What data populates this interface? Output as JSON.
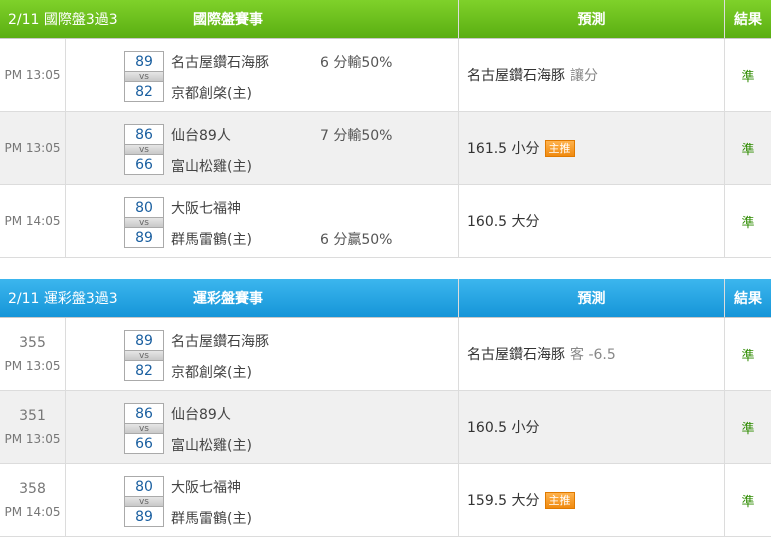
{
  "panels": [
    {
      "header": {
        "date_title": "2/11 國際盤3過3",
        "section_title": "國際盤賽事",
        "prediction": "預測",
        "result": "結果"
      },
      "rows": [
        {
          "game_no": "",
          "time": "PM 13:05",
          "away_score": "89",
          "vs": "vs",
          "home_score": "82",
          "away_team": "名古屋鑽石海豚",
          "home_team": "京都創棨(主)",
          "spread_top": "6 分輸50%",
          "spread_bottom": "",
          "pick": "名古屋鑽石海豚",
          "pick_extra": "讓分",
          "badge": "",
          "result": "準"
        },
        {
          "game_no": "",
          "time": "PM 13:05",
          "away_score": "86",
          "vs": "vs",
          "home_score": "66",
          "away_team": "仙台89人",
          "home_team": "富山松雞(主)",
          "spread_top": "7 分輸50%",
          "spread_bottom": "",
          "pick": "161.5 小分",
          "pick_extra": "",
          "badge": "主推",
          "result": "準"
        },
        {
          "game_no": "",
          "time": "PM 14:05",
          "away_score": "80",
          "vs": "vs",
          "home_score": "89",
          "away_team": "大阪七福神",
          "home_team": "群馬雷鶴(主)",
          "spread_top": "",
          "spread_bottom": "6 分贏50%",
          "pick": "160.5 大分",
          "pick_extra": "",
          "badge": "",
          "result": "準"
        }
      ]
    },
    {
      "header": {
        "date_title": "2/11 運彩盤3過3",
        "section_title": "運彩盤賽事",
        "prediction": "預測",
        "result": "結果"
      },
      "rows": [
        {
          "game_no": "355",
          "time": "PM 13:05",
          "away_score": "89",
          "vs": "vs",
          "home_score": "82",
          "away_team": "名古屋鑽石海豚",
          "home_team": "京都創棨(主)",
          "spread_top": "",
          "spread_bottom": "",
          "pick": "名古屋鑽石海豚",
          "pick_extra": "客 -6.5",
          "badge": "",
          "result": "準"
        },
        {
          "game_no": "351",
          "time": "PM 13:05",
          "away_score": "86",
          "vs": "vs",
          "home_score": "66",
          "away_team": "仙台89人",
          "home_team": "富山松雞(主)",
          "spread_top": "",
          "spread_bottom": "",
          "pick": "160.5 小分",
          "pick_extra": "",
          "badge": "",
          "result": "準"
        },
        {
          "game_no": "358",
          "time": "PM 14:05",
          "away_score": "80",
          "vs": "vs",
          "home_score": "89",
          "away_team": "大阪七福神",
          "home_team": "群馬雷鶴(主)",
          "spread_top": "",
          "spread_bottom": "",
          "pick": "159.5 大分",
          "pick_extra": "",
          "badge": "主推",
          "result": "準"
        }
      ]
    }
  ],
  "colors": {
    "intl_header": "#6cc11e",
    "lottery_header": "#25a6e4",
    "result_green": "#2e8b00",
    "badge_orange": "#f5a030"
  }
}
